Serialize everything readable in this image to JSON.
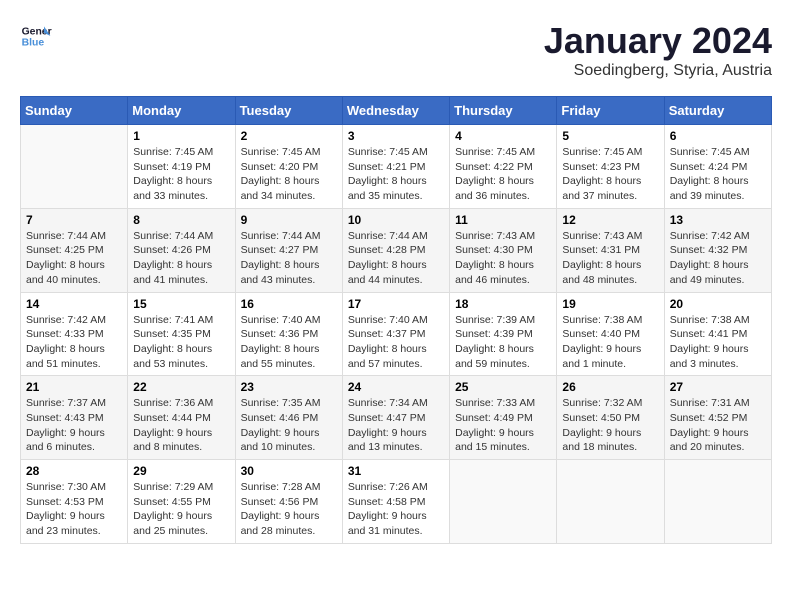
{
  "logo": {
    "line1": "General",
    "line2": "Blue"
  },
  "title": "January 2024",
  "subtitle": "Soedingberg, Styria, Austria",
  "weekdays": [
    "Sunday",
    "Monday",
    "Tuesday",
    "Wednesday",
    "Thursday",
    "Friday",
    "Saturday"
  ],
  "weeks": [
    [
      {
        "day": "",
        "sunrise": "",
        "sunset": "",
        "daylight": ""
      },
      {
        "day": "1",
        "sunrise": "Sunrise: 7:45 AM",
        "sunset": "Sunset: 4:19 PM",
        "daylight": "Daylight: 8 hours and 33 minutes."
      },
      {
        "day": "2",
        "sunrise": "Sunrise: 7:45 AM",
        "sunset": "Sunset: 4:20 PM",
        "daylight": "Daylight: 8 hours and 34 minutes."
      },
      {
        "day": "3",
        "sunrise": "Sunrise: 7:45 AM",
        "sunset": "Sunset: 4:21 PM",
        "daylight": "Daylight: 8 hours and 35 minutes."
      },
      {
        "day": "4",
        "sunrise": "Sunrise: 7:45 AM",
        "sunset": "Sunset: 4:22 PM",
        "daylight": "Daylight: 8 hours and 36 minutes."
      },
      {
        "day": "5",
        "sunrise": "Sunrise: 7:45 AM",
        "sunset": "Sunset: 4:23 PM",
        "daylight": "Daylight: 8 hours and 37 minutes."
      },
      {
        "day": "6",
        "sunrise": "Sunrise: 7:45 AM",
        "sunset": "Sunset: 4:24 PM",
        "daylight": "Daylight: 8 hours and 39 minutes."
      }
    ],
    [
      {
        "day": "7",
        "sunrise": "Sunrise: 7:44 AM",
        "sunset": "Sunset: 4:25 PM",
        "daylight": "Daylight: 8 hours and 40 minutes."
      },
      {
        "day": "8",
        "sunrise": "Sunrise: 7:44 AM",
        "sunset": "Sunset: 4:26 PM",
        "daylight": "Daylight: 8 hours and 41 minutes."
      },
      {
        "day": "9",
        "sunrise": "Sunrise: 7:44 AM",
        "sunset": "Sunset: 4:27 PM",
        "daylight": "Daylight: 8 hours and 43 minutes."
      },
      {
        "day": "10",
        "sunrise": "Sunrise: 7:44 AM",
        "sunset": "Sunset: 4:28 PM",
        "daylight": "Daylight: 8 hours and 44 minutes."
      },
      {
        "day": "11",
        "sunrise": "Sunrise: 7:43 AM",
        "sunset": "Sunset: 4:30 PM",
        "daylight": "Daylight: 8 hours and 46 minutes."
      },
      {
        "day": "12",
        "sunrise": "Sunrise: 7:43 AM",
        "sunset": "Sunset: 4:31 PM",
        "daylight": "Daylight: 8 hours and 48 minutes."
      },
      {
        "day": "13",
        "sunrise": "Sunrise: 7:42 AM",
        "sunset": "Sunset: 4:32 PM",
        "daylight": "Daylight: 8 hours and 49 minutes."
      }
    ],
    [
      {
        "day": "14",
        "sunrise": "Sunrise: 7:42 AM",
        "sunset": "Sunset: 4:33 PM",
        "daylight": "Daylight: 8 hours and 51 minutes."
      },
      {
        "day": "15",
        "sunrise": "Sunrise: 7:41 AM",
        "sunset": "Sunset: 4:35 PM",
        "daylight": "Daylight: 8 hours and 53 minutes."
      },
      {
        "day": "16",
        "sunrise": "Sunrise: 7:40 AM",
        "sunset": "Sunset: 4:36 PM",
        "daylight": "Daylight: 8 hours and 55 minutes."
      },
      {
        "day": "17",
        "sunrise": "Sunrise: 7:40 AM",
        "sunset": "Sunset: 4:37 PM",
        "daylight": "Daylight: 8 hours and 57 minutes."
      },
      {
        "day": "18",
        "sunrise": "Sunrise: 7:39 AM",
        "sunset": "Sunset: 4:39 PM",
        "daylight": "Daylight: 8 hours and 59 minutes."
      },
      {
        "day": "19",
        "sunrise": "Sunrise: 7:38 AM",
        "sunset": "Sunset: 4:40 PM",
        "daylight": "Daylight: 9 hours and 1 minute."
      },
      {
        "day": "20",
        "sunrise": "Sunrise: 7:38 AM",
        "sunset": "Sunset: 4:41 PM",
        "daylight": "Daylight: 9 hours and 3 minutes."
      }
    ],
    [
      {
        "day": "21",
        "sunrise": "Sunrise: 7:37 AM",
        "sunset": "Sunset: 4:43 PM",
        "daylight": "Daylight: 9 hours and 6 minutes."
      },
      {
        "day": "22",
        "sunrise": "Sunrise: 7:36 AM",
        "sunset": "Sunset: 4:44 PM",
        "daylight": "Daylight: 9 hours and 8 minutes."
      },
      {
        "day": "23",
        "sunrise": "Sunrise: 7:35 AM",
        "sunset": "Sunset: 4:46 PM",
        "daylight": "Daylight: 9 hours and 10 minutes."
      },
      {
        "day": "24",
        "sunrise": "Sunrise: 7:34 AM",
        "sunset": "Sunset: 4:47 PM",
        "daylight": "Daylight: 9 hours and 13 minutes."
      },
      {
        "day": "25",
        "sunrise": "Sunrise: 7:33 AM",
        "sunset": "Sunset: 4:49 PM",
        "daylight": "Daylight: 9 hours and 15 minutes."
      },
      {
        "day": "26",
        "sunrise": "Sunrise: 7:32 AM",
        "sunset": "Sunset: 4:50 PM",
        "daylight": "Daylight: 9 hours and 18 minutes."
      },
      {
        "day": "27",
        "sunrise": "Sunrise: 7:31 AM",
        "sunset": "Sunset: 4:52 PM",
        "daylight": "Daylight: 9 hours and 20 minutes."
      }
    ],
    [
      {
        "day": "28",
        "sunrise": "Sunrise: 7:30 AM",
        "sunset": "Sunset: 4:53 PM",
        "daylight": "Daylight: 9 hours and 23 minutes."
      },
      {
        "day": "29",
        "sunrise": "Sunrise: 7:29 AM",
        "sunset": "Sunset: 4:55 PM",
        "daylight": "Daylight: 9 hours and 25 minutes."
      },
      {
        "day": "30",
        "sunrise": "Sunrise: 7:28 AM",
        "sunset": "Sunset: 4:56 PM",
        "daylight": "Daylight: 9 hours and 28 minutes."
      },
      {
        "day": "31",
        "sunrise": "Sunrise: 7:26 AM",
        "sunset": "Sunset: 4:58 PM",
        "daylight": "Daylight: 9 hours and 31 minutes."
      },
      {
        "day": "",
        "sunrise": "",
        "sunset": "",
        "daylight": ""
      },
      {
        "day": "",
        "sunrise": "",
        "sunset": "",
        "daylight": ""
      },
      {
        "day": "",
        "sunrise": "",
        "sunset": "",
        "daylight": ""
      }
    ]
  ]
}
